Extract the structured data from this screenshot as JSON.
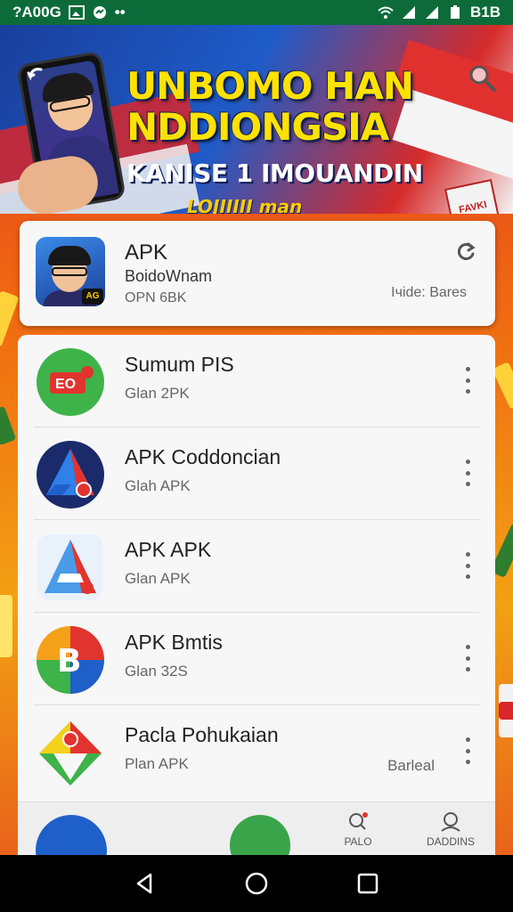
{
  "status_bar": {
    "time": "?A00G",
    "right_text": "B1B"
  },
  "banner": {
    "title_line1": "UNBOMO HAN",
    "title_line2": "NDDIONGSIA",
    "subtitle": "KANISE 1 IMOUANDIN",
    "tag": "LOJIIIII man",
    "sticker_text": "FAVKI"
  },
  "featured": {
    "title": "APK",
    "developer": "BoidoWnam",
    "size": "OPN 6BK",
    "meta": "Iчide: Bares",
    "badge": "AG"
  },
  "list": {
    "items": [
      {
        "title": "Sumum PIS",
        "subtitle": "Glan 2PK",
        "meta": "",
        "icon": "red-tag-icon",
        "icon_text": "EO"
      },
      {
        "title": "APK Coddoncian",
        "subtitle": "Glah APK",
        "meta": "",
        "icon": "triangle-logo-icon"
      },
      {
        "title": "APK APK",
        "subtitle": "Glan APK",
        "meta": "",
        "icon": "letter-a-icon"
      },
      {
        "title": "APK Bmtis",
        "subtitle": "Glan 32S",
        "meta": "",
        "icon": "letter-b-icon",
        "icon_text": "B"
      },
      {
        "title": "Pacla Pohukaian",
        "subtitle": "Plan APK",
        "meta": "Barleal",
        "icon": "tricolor-icon"
      }
    ]
  },
  "app_nav": {
    "item_right1": "PALO",
    "item_right2": "DADDINS"
  },
  "colors": {
    "status_bg": "#0d6b3a",
    "banner_yellow": "#ffe200",
    "card_bg": "#f7f7f7"
  }
}
